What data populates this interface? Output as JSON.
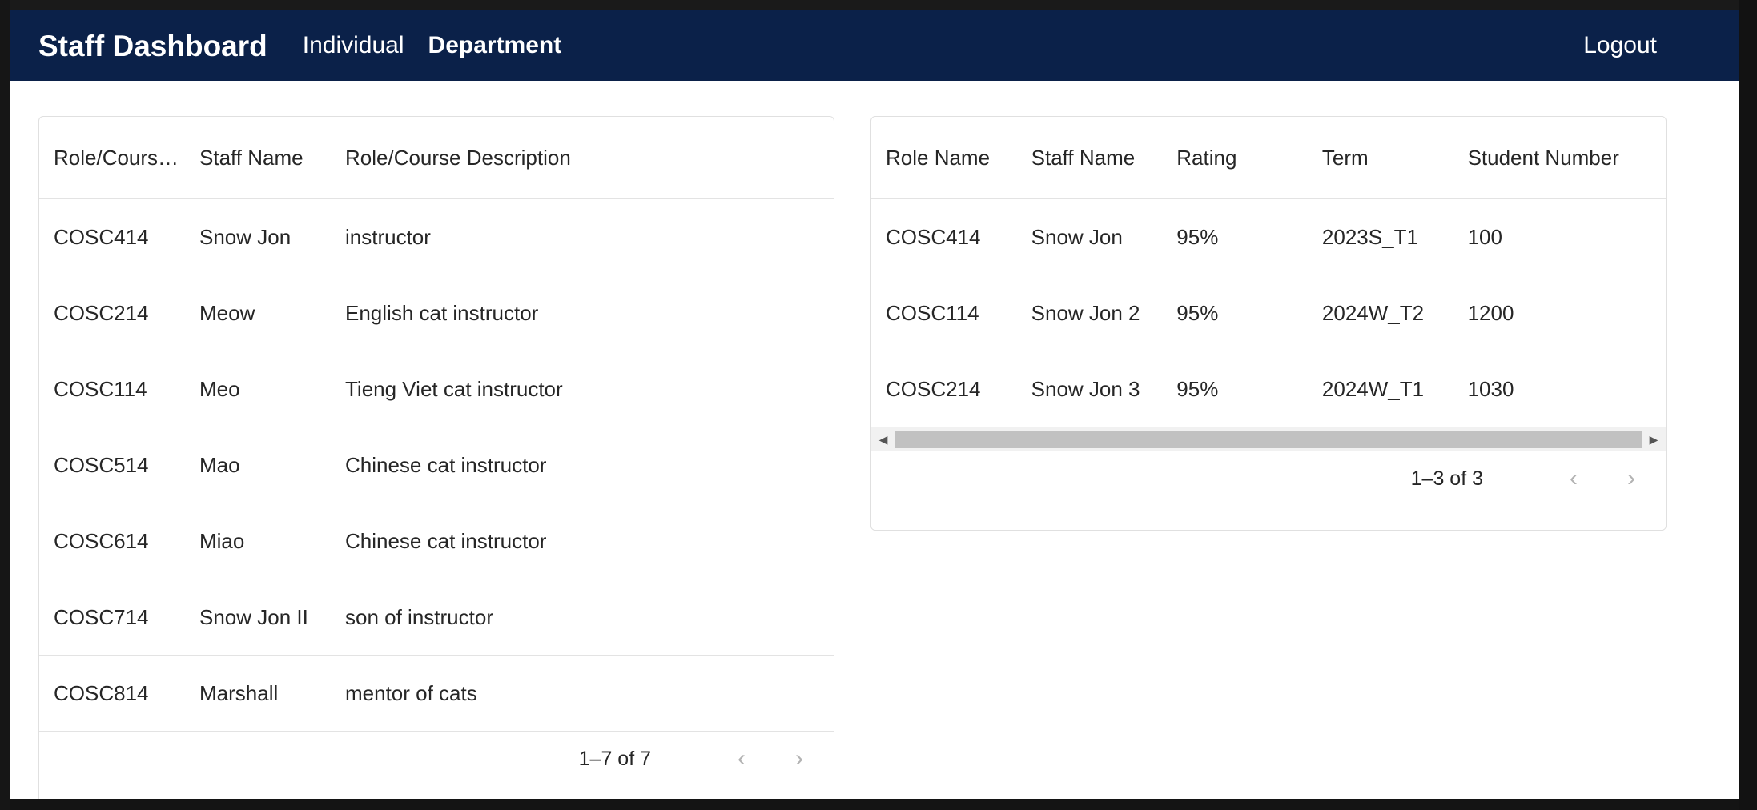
{
  "nav": {
    "brand": "Staff Dashboard",
    "links": [
      "Individual",
      "Department"
    ],
    "active": "Department",
    "logout": "Logout"
  },
  "colors": {
    "navbar": "#0b2149",
    "border": "#e0e0e0"
  },
  "left_table": {
    "headers": [
      "Role/Cours…",
      "Staff Name",
      "Role/Course Description"
    ],
    "rows": [
      [
        "COSC414",
        "Snow Jon",
        "instructor"
      ],
      [
        "COSC214",
        "Meow",
        "English cat instructor"
      ],
      [
        "COSC114",
        "Meo",
        "Tieng Viet cat instructor"
      ],
      [
        "COSC514",
        "Mao",
        "Chinese cat instructor"
      ],
      [
        "COSC614",
        "Miao",
        "Chinese cat instructor"
      ],
      [
        "COSC714",
        "Snow Jon II",
        "son of instructor"
      ],
      [
        "COSC814",
        "Marshall",
        "mentor of cats"
      ]
    ],
    "pagination": "1–7 of 7"
  },
  "right_table": {
    "headers": [
      "Role Name",
      "Staff Name",
      "Rating",
      "Term",
      "Student Number"
    ],
    "rows": [
      [
        "COSC414",
        "Snow Jon",
        "95%",
        "2023S_T1",
        "100"
      ],
      [
        "COSC114",
        "Snow Jon 2",
        "95%",
        "2024W_T2",
        "1200"
      ],
      [
        "COSC214",
        "Snow Jon 3",
        "95%",
        "2024W_T1",
        "1030"
      ]
    ],
    "pagination": "1–3 of 3"
  },
  "icons": {
    "prev": "chevron-left-icon",
    "next": "chevron-right-icon"
  }
}
